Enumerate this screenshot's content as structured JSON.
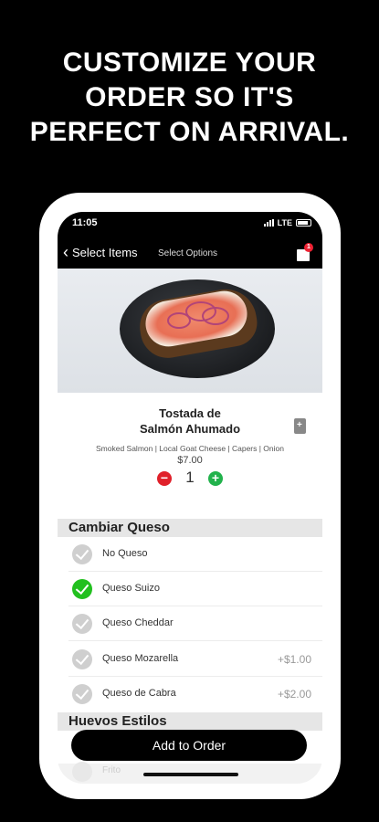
{
  "headline": [
    "CUSTOMIZE YOUR",
    "ORDER SO IT'S",
    "PERFECT ON ARRIVAL."
  ],
  "status": {
    "time": "11:05",
    "network": "LTE"
  },
  "nav": {
    "back_label": "Select Items",
    "subtitle": "Select Options",
    "cart_count": "1"
  },
  "product": {
    "name_line1": "Tostada de",
    "name_line2": "Salmón Ahumado",
    "description": "Smoked Salmon | Local Goat Cheese | Capers | Onion",
    "price": "$7.00",
    "quantity": "1"
  },
  "sections": [
    {
      "title": "Cambiar Queso",
      "options": [
        {
          "label": "No Queso",
          "price": "",
          "selected": false
        },
        {
          "label": "Queso Suizo",
          "price": "",
          "selected": true
        },
        {
          "label": "Queso Cheddar",
          "price": "",
          "selected": false
        },
        {
          "label": "Queso Mozarella",
          "price": "+$1.00",
          "selected": false
        },
        {
          "label": "Queso de Cabra",
          "price": "+$2.00",
          "selected": false
        }
      ]
    },
    {
      "title": "Huevos Estilos",
      "options": [
        {
          "label": "Frito",
          "price": "",
          "selected": false
        }
      ]
    }
  ],
  "cta": {
    "label": "Add to Order"
  },
  "colors": {
    "accent_green": "#22c01f",
    "minus_red": "#e0202a",
    "plus_green": "#22b24c"
  }
}
